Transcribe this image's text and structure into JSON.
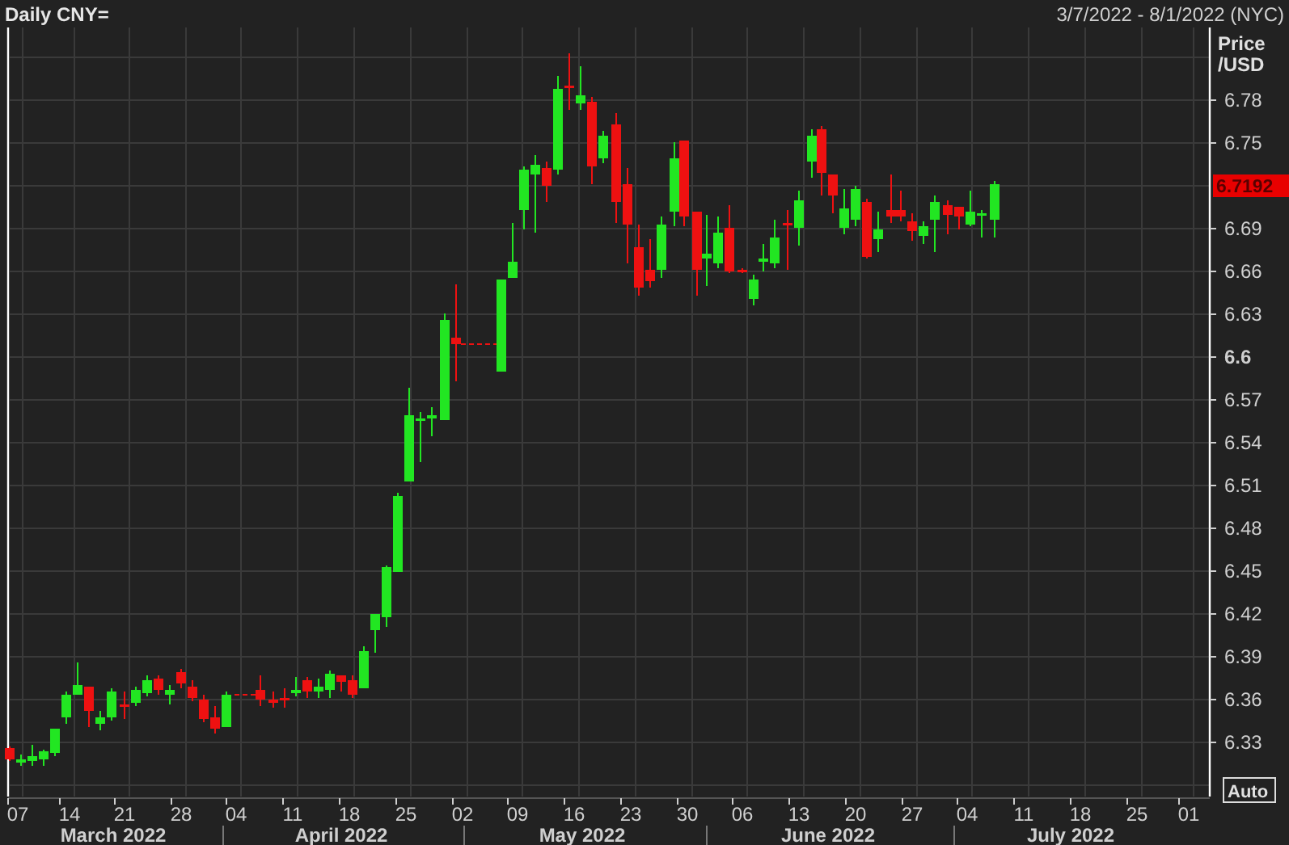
{
  "header": {
    "title": "Daily CNY=",
    "range": "3/7/2022 - 8/1/2022 (NYC)"
  },
  "price_axis": {
    "title_lines": [
      "Price",
      "/USD"
    ],
    "ticks": [
      {
        "label": "6.78",
        "major": false
      },
      {
        "label": "6.75",
        "major": false
      },
      {
        "label": "6.69",
        "major": false
      },
      {
        "label": "6.66",
        "major": false
      },
      {
        "label": "6.63",
        "major": false
      },
      {
        "label": "6.6",
        "major": true
      },
      {
        "label": "6.57",
        "major": false
      },
      {
        "label": "6.54",
        "major": false
      },
      {
        "label": "6.51",
        "major": false
      },
      {
        "label": "6.48",
        "major": false
      },
      {
        "label": "6.45",
        "major": false
      },
      {
        "label": "6.42",
        "major": false
      },
      {
        "label": "6.39",
        "major": false
      },
      {
        "label": "6.36",
        "major": false
      },
      {
        "label": "6.33",
        "major": false
      }
    ],
    "current_price": "6.7192",
    "auto_button": "Auto"
  },
  "date_axis": {
    "days": [
      "07",
      "14",
      "21",
      "28",
      "04",
      "11",
      "18",
      "25",
      "02",
      "09",
      "16",
      "23",
      "30",
      "06",
      "13",
      "20",
      "27",
      "04",
      "11",
      "18",
      "25",
      "01"
    ],
    "months": [
      "March 2022",
      "April 2022",
      "May 2022",
      "June 2022",
      "July 2022"
    ]
  }
}
